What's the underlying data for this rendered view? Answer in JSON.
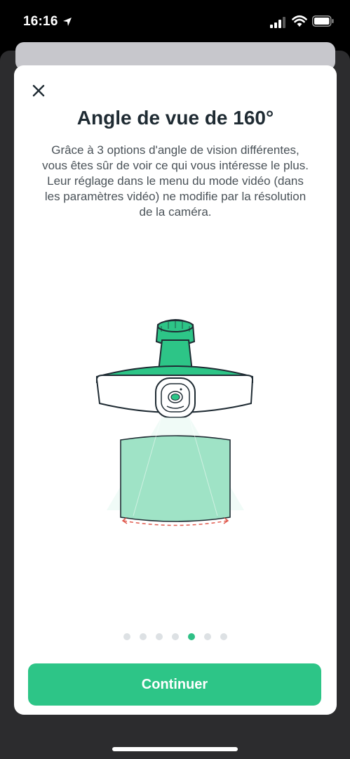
{
  "status_bar": {
    "time": "16:16",
    "icons": [
      "location-arrow-icon",
      "cellular-signal-icon",
      "wifi-icon",
      "battery-icon"
    ]
  },
  "modal": {
    "close_icon": "close-icon",
    "title": "Angle de vue de 160°",
    "description_lines": [
      "Grâce à 3 options d'angle de vision différentes,",
      "vous êtes sûr de voir ce qui vous intéresse le plus.",
      "Leur réglage dans le menu du mode vidéo (dans",
      "les paramètres vidéo) ne modifie par la résolution",
      "de la caméra."
    ],
    "pagination": {
      "total": 7,
      "current": 5
    },
    "continue_label": "Continuer"
  },
  "colors": {
    "accent": "#2dc587",
    "title": "#1f2b33",
    "body_text": "#4a5258",
    "dot_inactive": "#dde1e4",
    "illustration_fill": "#9fe3c6",
    "arrow_dashed": "#e05a4e"
  }
}
